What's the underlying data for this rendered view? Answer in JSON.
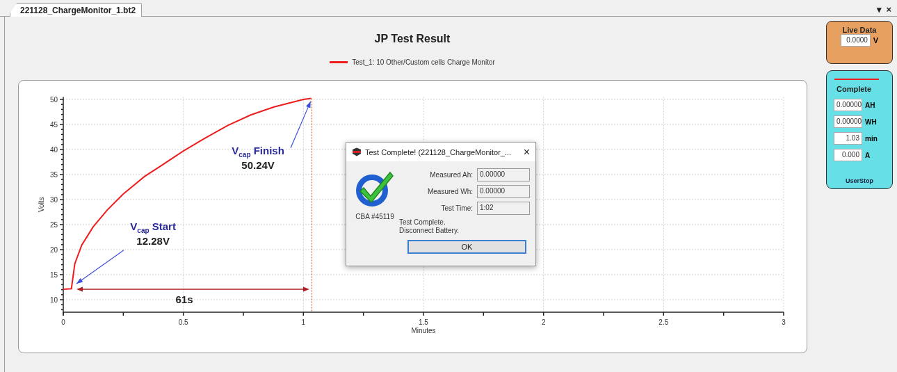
{
  "tabs": [
    {
      "label": "221128_ChargeMonitor_1.bt2",
      "selected": true
    }
  ],
  "window_controls": [
    "▾",
    "×"
  ],
  "chart": {
    "chart_data": {
      "type": "line",
      "title": "JP Test Result",
      "xlabel": "Minutes",
      "ylabel": "Volts",
      "xlim": [
        0,
        3
      ],
      "ylim": [
        7.5,
        50.5
      ],
      "xticks": [
        0,
        0.5,
        1,
        1.5,
        2,
        2.5,
        3
      ],
      "yticks": [
        10,
        15,
        20,
        25,
        30,
        35,
        40,
        45,
        50
      ],
      "x": [
        0,
        0.034,
        0.048,
        0.077,
        0.125,
        0.183,
        0.25,
        0.338,
        0.405,
        0.5,
        0.588,
        0.685,
        0.781,
        0.878,
        1.0,
        1.032
      ],
      "series": [
        {
          "name": "Test_1: 10 Other/Custom cells Charge Monitor",
          "color": "#ee1c1c",
          "values": [
            12.1,
            12.2,
            17.2,
            20.9,
            24.6,
            27.9,
            31.1,
            34.6,
            36.7,
            39.7,
            42.2,
            44.8,
            46.9,
            48.5,
            50.0,
            50.2
          ]
        }
      ],
      "grid": true,
      "ref_lines": [
        {
          "axis": "x",
          "value": 1.035,
          "color": "#e06030"
        }
      ],
      "annotations": [
        "V$_{cap}$ Start",
        "12.28V",
        "V$_{cap}$ Finish",
        "50.24V",
        "61s"
      ]
    }
  },
  "live_data": {
    "title": "Live Data",
    "value": "0.0000",
    "unit": "V"
  },
  "status_panel": {
    "status": "Complete",
    "readings": [
      {
        "value": "0.00000",
        "unit": "AH"
      },
      {
        "value": "0.00000",
        "unit": "WH"
      },
      {
        "value": "1.03",
        "unit": "min"
      },
      {
        "value": "0.000",
        "unit": "A"
      }
    ],
    "footer": "UserStop"
  },
  "dialog": {
    "title": "Test Complete! (221128_ChargeMonitor_...",
    "close": "×",
    "fields": [
      {
        "label": "Measured Ah:",
        "value": "0.00000"
      },
      {
        "label": "Measured Wh:",
        "value": "0.00000"
      },
      {
        "label": "Test Time:",
        "value": "1:02"
      }
    ],
    "device": "CBA #45119",
    "message": [
      "Test Complete.",
      "Disconnect Battery."
    ],
    "button": {
      "label": "OK",
      "focused": true
    }
  }
}
